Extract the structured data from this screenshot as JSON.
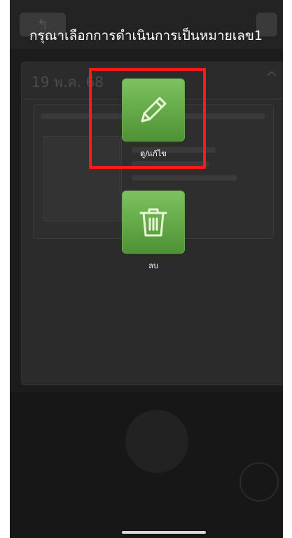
{
  "background": {
    "back_glyph": "↰",
    "date_label": "19 พ.ค. 68",
    "chevron": "^"
  },
  "dialog": {
    "prompt": "กรุณาเลือกการดำเนินการเป็นหมายเลข1"
  },
  "actions": [
    {
      "id": "edit",
      "label": "ดู/แก้ไข",
      "icon": "pencil-icon"
    },
    {
      "id": "delete",
      "label": "ลบ",
      "icon": "trash-icon"
    }
  ],
  "colors": {
    "tile_green": "#5fa843",
    "highlight_red": "#ff1a1a"
  }
}
